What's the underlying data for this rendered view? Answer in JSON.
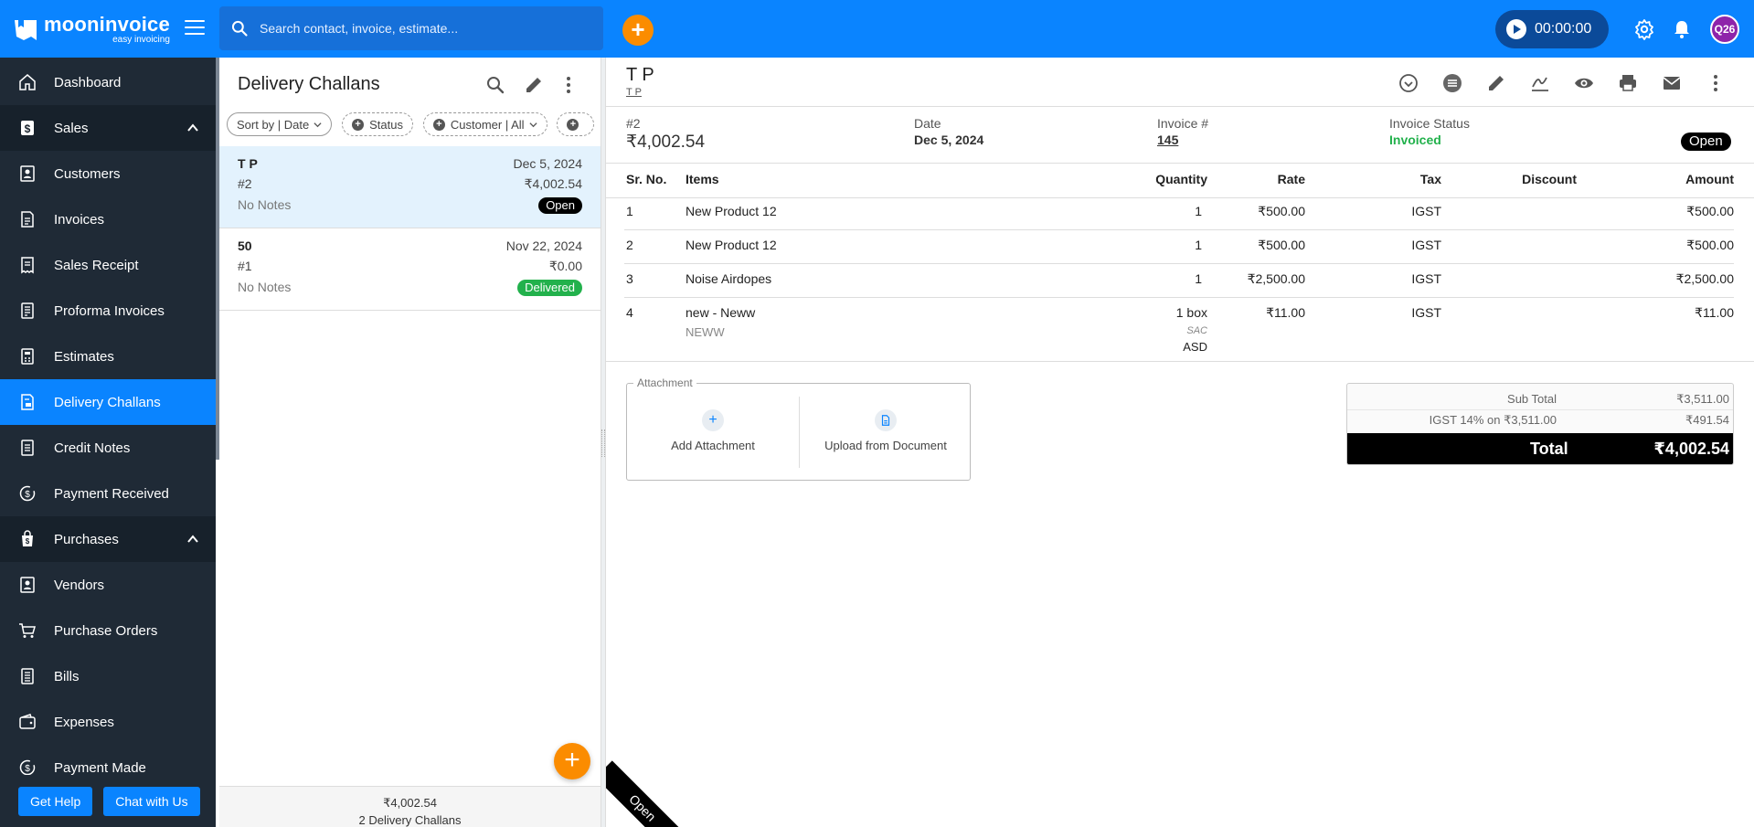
{
  "app": {
    "logo_name": "mooninvoice",
    "logo_tagline": "easy invoicing",
    "search_placeholder": "Search contact, invoice, estimate...",
    "timer": "00:00:00",
    "avatar": "Q26",
    "accent_color": "#0a84ff"
  },
  "sidebar": {
    "dashboard": "Dashboard",
    "sales_section": "Sales",
    "sales_items": [
      "Customers",
      "Invoices",
      "Sales Receipt",
      "Proforma Invoices",
      "Estimates",
      "Delivery Challans",
      "Credit Notes",
      "Payment Received"
    ],
    "purchases_section": "Purchases",
    "purchase_items": [
      "Vendors",
      "Purchase Orders",
      "Bills",
      "Expenses",
      "Payment Made"
    ],
    "get_help": "Get Help",
    "chat": "Chat with Us"
  },
  "list": {
    "title": "Delivery Challans",
    "filters": {
      "sort": "Sort by | Date",
      "status": "Status",
      "customer": "Customer | All"
    },
    "cards": [
      {
        "name": "T P",
        "date": "Dec 5, 2024",
        "number": "#2",
        "amount": "₹4,002.54",
        "notes": "No Notes",
        "status": "Open"
      },
      {
        "name": "50",
        "date": "Nov 22, 2024",
        "number": "#1",
        "amount": "₹0.00",
        "notes": "No Notes",
        "status": "Delivered"
      }
    ],
    "footer_total": "₹4,002.54",
    "footer_count": "2 Delivery Challans"
  },
  "detail": {
    "title": "T P",
    "subtitle": "T P",
    "number": "#2",
    "amount": "₹4,002.54",
    "date_label": "Date",
    "date": "Dec 5, 2024",
    "invoice_label": "Invoice #",
    "invoice_no": "145",
    "invoice_status_label": "Invoice Status",
    "invoice_status": "Invoiced",
    "status_badge": "Open",
    "columns": {
      "sr": "Sr. No.",
      "items": "Items",
      "qty": "Quantity",
      "rate": "Rate",
      "tax": "Tax",
      "discount": "Discount",
      "amount": "Amount"
    },
    "rows": [
      {
        "sr": "1",
        "item": "New Product 12",
        "desc": "",
        "qty": "1",
        "sac_label": "",
        "sac": "",
        "rate": "₹500.00",
        "tax": "IGST",
        "amount": "₹500.00"
      },
      {
        "sr": "2",
        "item": "New Product 12",
        "desc": "",
        "qty": "1",
        "sac_label": "",
        "sac": "",
        "rate": "₹500.00",
        "tax": "IGST",
        "amount": "₹500.00"
      },
      {
        "sr": "3",
        "item": "Noise Airdopes",
        "desc": "",
        "qty": "1",
        "sac_label": "",
        "sac": "",
        "rate": "₹2,500.00",
        "tax": "IGST",
        "amount": "₹2,500.00"
      },
      {
        "sr": "4",
        "item": "new - Neww",
        "desc": "NEWW",
        "qty": "1 box",
        "sac_label": "SAC",
        "sac": "ASD",
        "rate": "₹11.00",
        "tax": "IGST",
        "amount": "₹11.00"
      }
    ],
    "attachment_legend": "Attachment",
    "add_attachment": "Add Attachment",
    "upload_document": "Upload from Document",
    "sub_total_label": "Sub Total",
    "sub_total": "₹3,511.00",
    "tax_label": "IGST 14% on ₹3,511.00",
    "tax_value": "₹491.54",
    "total_label": "Total",
    "total": "₹4,002.54",
    "ribbon": "Open"
  }
}
